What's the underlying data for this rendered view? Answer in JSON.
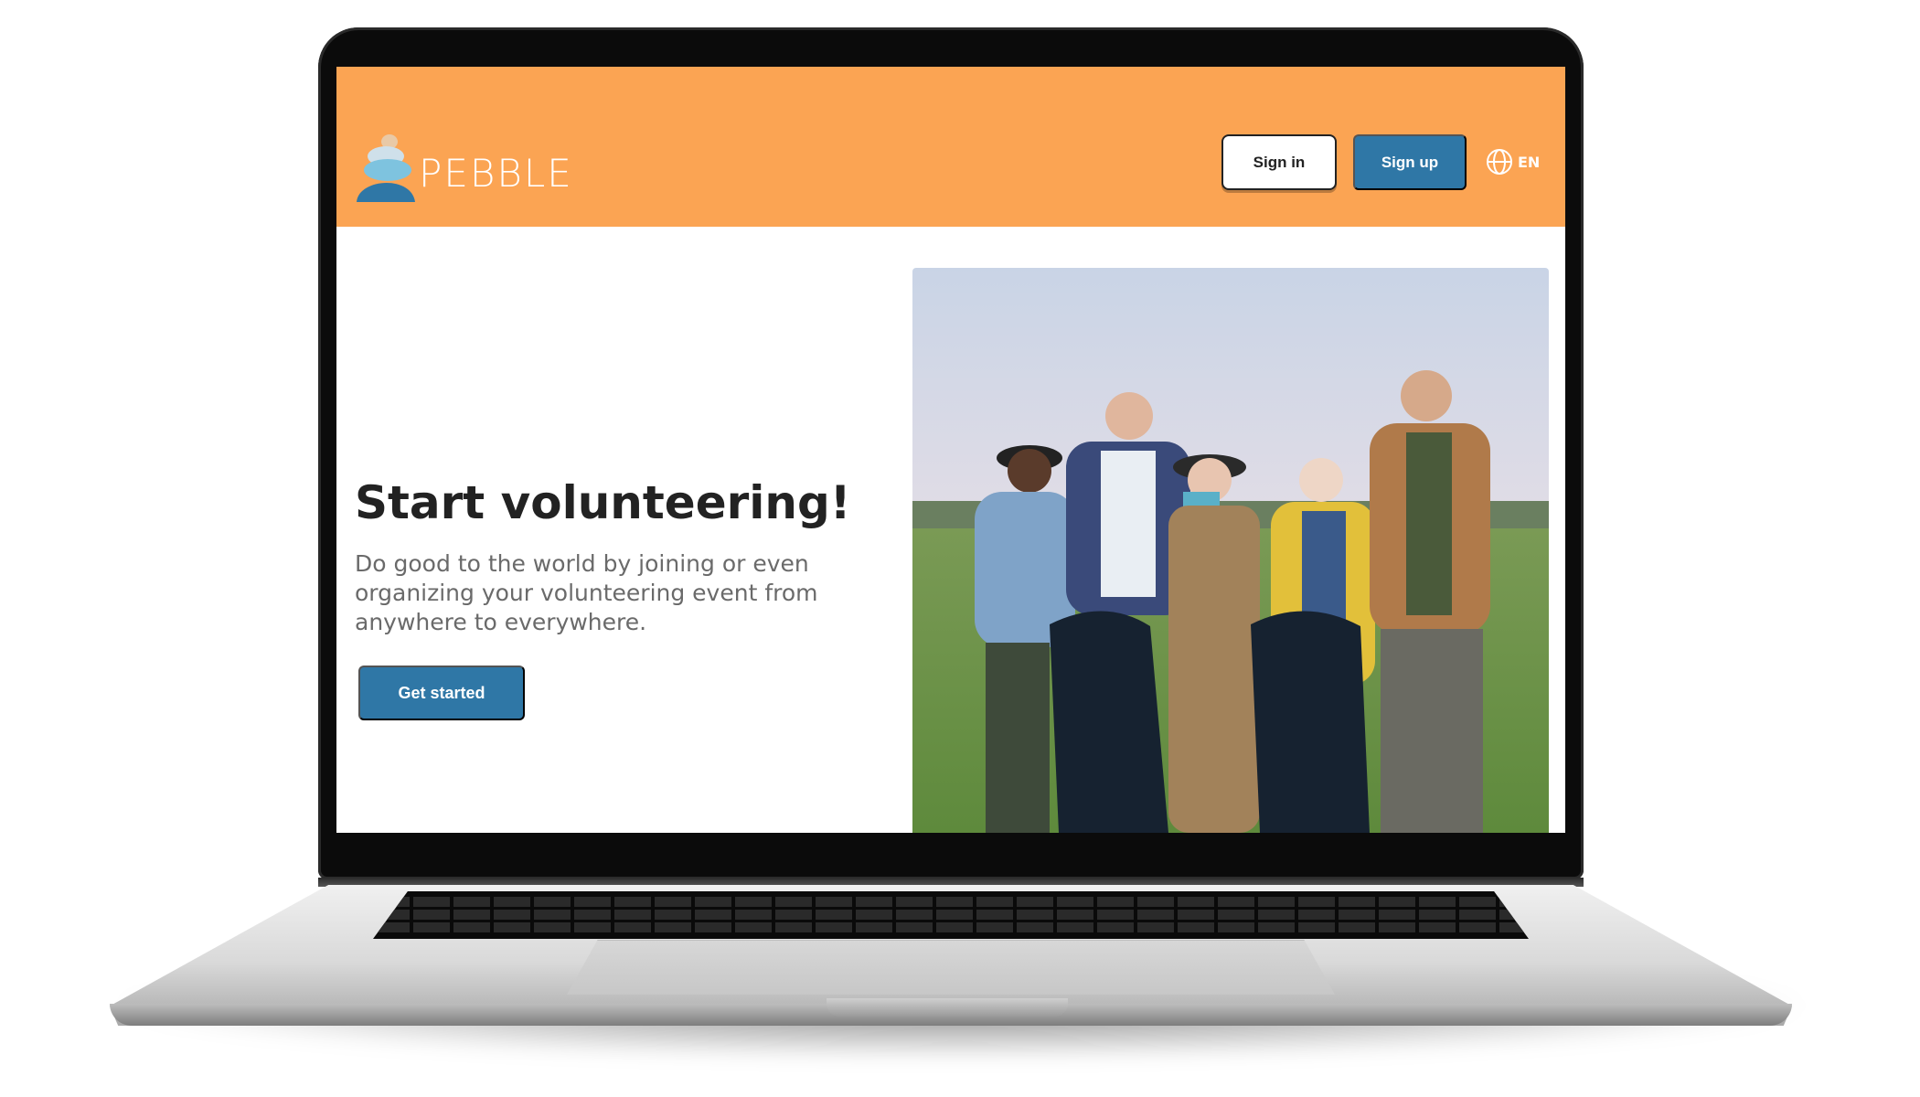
{
  "brand": {
    "name": "PEBBLE"
  },
  "header": {
    "sign_in": "Sign in",
    "sign_up": "Sign up",
    "language": "EN"
  },
  "hero": {
    "title": "Start volunteering!",
    "subtitle": "Do good to the world by joining or even organizing your volunteering event from anywhere to everywhere.",
    "cta": "Get started"
  },
  "colors": {
    "header_bg": "#fba453",
    "primary_button": "#2f77a6",
    "text_dark": "#222222",
    "text_muted": "#6a6a6a"
  },
  "icons": {
    "language": "globe-icon"
  }
}
